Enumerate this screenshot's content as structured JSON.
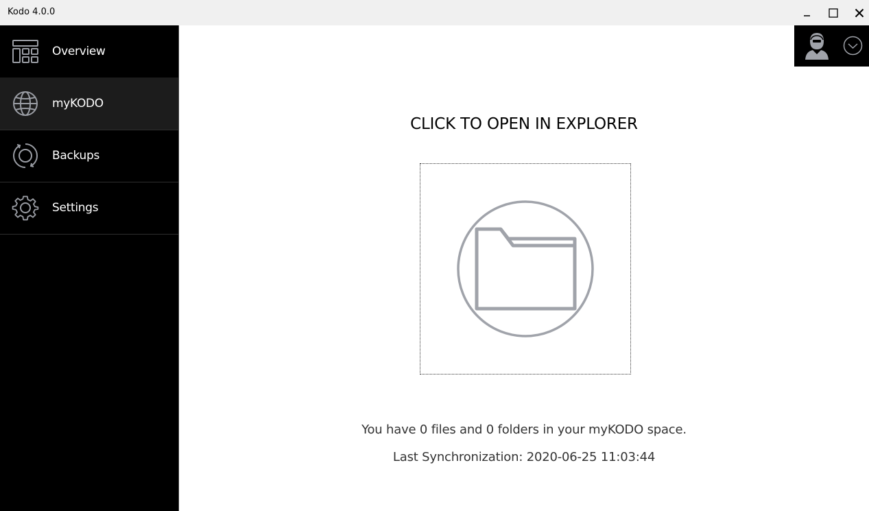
{
  "window": {
    "title": "Kodo 4.0.0",
    "controls": [
      "minimize",
      "maximize",
      "close"
    ]
  },
  "sidebar": {
    "items": [
      {
        "label": "Overview",
        "icon": "dashboard-icon",
        "active": false
      },
      {
        "label": "myKODO",
        "icon": "globe-icon",
        "active": true
      },
      {
        "label": "Backups",
        "icon": "sync-icon",
        "active": false
      },
      {
        "label": "Settings",
        "icon": "gear-icon",
        "active": false
      }
    ]
  },
  "user": {
    "avatar_icon": "user-avatar-icon",
    "menu_icon": "chevron-down-icon"
  },
  "main": {
    "headline": "CLICK TO OPEN IN EXPLORER",
    "open_icon": "folder-icon",
    "files_info": "You have 0 files and 0 folders in your myKODO space.",
    "sync_info": "Last Synchronization: 2020-06-25 11:03:44"
  },
  "colors": {
    "sidebar_bg": "#000000",
    "sidebar_active": "#1c1c1c",
    "titlebar_bg": "#f0f0f0",
    "icon_gray": "#a0a3aa"
  }
}
